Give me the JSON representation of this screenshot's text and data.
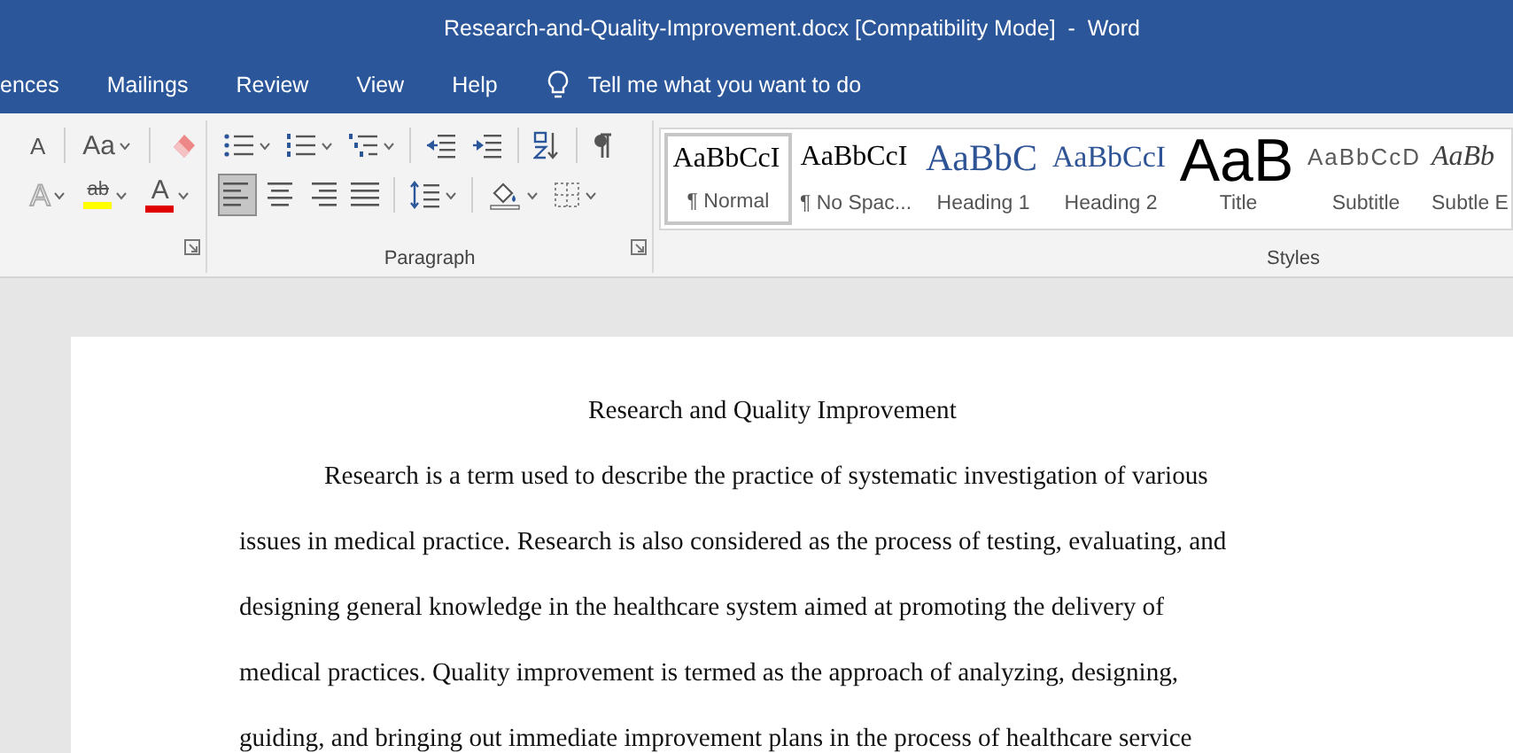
{
  "window": {
    "title": "Research-and-Quality-Improvement.docx [Compatibility Mode]  -  Word"
  },
  "ribbon_tabs": [
    {
      "label": "ences",
      "selected": false
    },
    {
      "label": "Mailings",
      "selected": false
    },
    {
      "label": "Review",
      "selected": false
    },
    {
      "label": "View",
      "selected": false
    },
    {
      "label": "Help",
      "selected": false
    }
  ],
  "tell_me": {
    "placeholder": "Tell me what you want to do"
  },
  "font_group": {
    "row_1": [
      {
        "kind": "shrink-font",
        "glyph": "A"
      },
      {
        "kind": "separator"
      },
      {
        "kind": "change-case",
        "glyph": "Aa",
        "caret": true
      },
      {
        "kind": "separator"
      },
      {
        "kind": "clear-formatting"
      }
    ],
    "row_2": [
      {
        "kind": "text-effects",
        "glyph": "A",
        "caret": true
      },
      {
        "kind": "highlight",
        "glyph": "ab",
        "caret": true
      },
      {
        "kind": "font-color",
        "glyph": "A",
        "caret": true
      }
    ]
  },
  "paragraph_group": {
    "label": "Paragraph",
    "row_1": [
      {
        "kind": "bullets",
        "caret": true
      },
      {
        "kind": "numbering",
        "caret": true
      },
      {
        "kind": "multilevel",
        "caret": true
      },
      {
        "kind": "separator"
      },
      {
        "kind": "decrease-indent"
      },
      {
        "kind": "increase-indent"
      },
      {
        "kind": "separator"
      },
      {
        "kind": "sort"
      },
      {
        "kind": "separator"
      },
      {
        "kind": "pilcrow"
      }
    ],
    "row_2": [
      {
        "kind": "align-left",
        "selected": true
      },
      {
        "kind": "align-center",
        "selected": false
      },
      {
        "kind": "align-right",
        "selected": false
      },
      {
        "kind": "justify",
        "selected": false
      },
      {
        "kind": "separator"
      },
      {
        "kind": "line-spacing",
        "caret": true
      },
      {
        "kind": "separator"
      },
      {
        "kind": "shading",
        "caret": true
      },
      {
        "kind": "borders",
        "caret": true
      }
    ]
  },
  "styles_group": {
    "label": "Styles",
    "items": [
      {
        "kind": "normal",
        "preview": "AaBbCcI",
        "name": "¶ Normal",
        "selected": true
      },
      {
        "kind": "no-spacing",
        "preview": "AaBbCcI",
        "name": "¶ No Spac...",
        "selected": false
      },
      {
        "kind": "heading-1",
        "preview": "AaBbC",
        "name": "Heading 1",
        "selected": false
      },
      {
        "kind": "heading-2",
        "preview": "AaBbCcI",
        "name": "Heading 2",
        "selected": false
      },
      {
        "kind": "title",
        "preview": "AaB",
        "name": "Title",
        "selected": false
      },
      {
        "kind": "subtitle",
        "preview": "AaBbCcD",
        "name": "Subtitle",
        "selected": false
      },
      {
        "kind": "subtle-emphasis",
        "preview": "AaBb",
        "name": "Subtle E",
        "selected": false
      }
    ]
  },
  "document": {
    "title": "Research and Quality Improvement",
    "lines": [
      "Research is a term used to describe the practice of systematic investigation of various",
      "issues in medical practice. Research is also considered as the process of testing, evaluating, and",
      "designing general knowledge in the healthcare system aimed at promoting the delivery of",
      "medical practices. Quality improvement is termed as the approach of analyzing, designing,",
      "guiding, and bringing out immediate improvement plans in the process of healthcare service"
    ]
  }
}
